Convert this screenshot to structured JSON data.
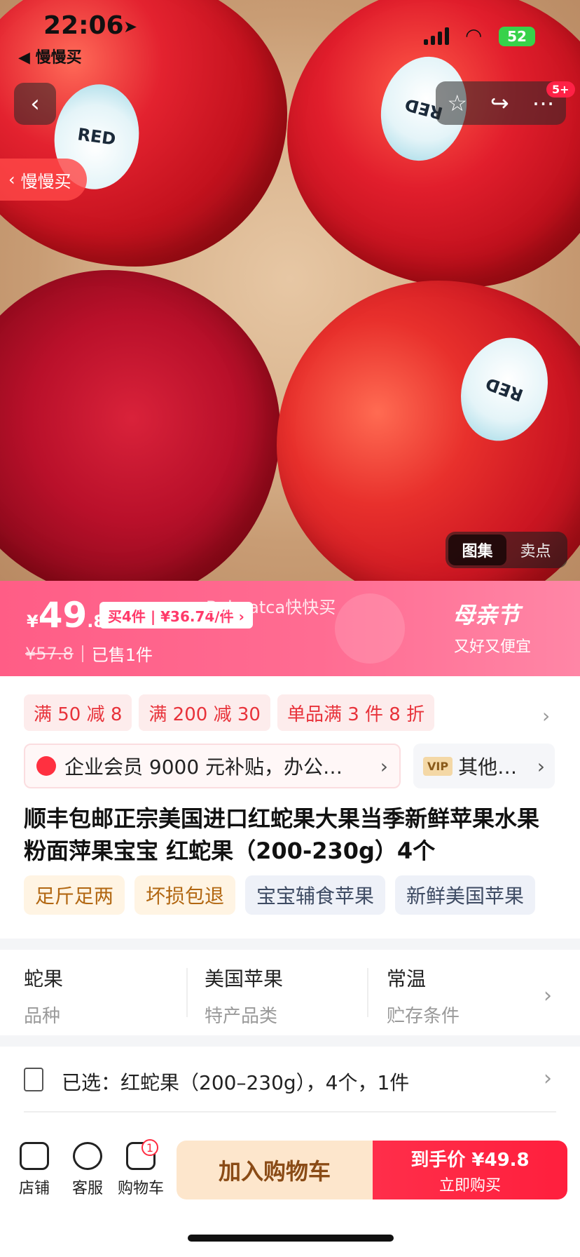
{
  "status_bar": {
    "time": "22:06",
    "back_app": "◀ 慢慢买",
    "battery": "52"
  },
  "hero": {
    "store_back_label": "慢慢买",
    "cart_badge": "5+",
    "gallery_tabs": [
      "图集",
      "卖点"
    ],
    "sticker_text": "RED"
  },
  "price": {
    "yen": "¥",
    "int": "49",
    "dec": ".8",
    "multi_offer": "买4件 | ¥36.74/件 ›",
    "watermark": "Babeatca快快买",
    "original": "¥57.8",
    "sold": "已售1件",
    "promo_title": "母亲节",
    "promo_sub": "又好又便宜"
  },
  "coupons": [
    "满 50 减 8",
    "满 200 减 30",
    "单品满 3 件 8 折"
  ],
  "member": {
    "text": "企业会员 9000 元补贴，办公…",
    "vip_tag": "VIP",
    "vip_text": "其他…"
  },
  "product_title": "顺丰包邮正宗美国进口红蛇果大果当季新鲜苹果水果粉面萍果宝宝 红蛇果（200-230g）4个",
  "tags": [
    "足斤足两",
    "坏损包退",
    "宝宝辅食苹果",
    "新鲜美国苹果"
  ],
  "attributes": [
    {
      "value": "蛇果",
      "key": "品种"
    },
    {
      "value": "美国苹果",
      "key": "特产品类"
    },
    {
      "value": "常温",
      "key": "贮存条件"
    }
  ],
  "selected": "已选：红蛇果（200–230g），4个，1件",
  "bottom_bar": {
    "shop": "店铺",
    "service": "客服",
    "cart": "购物车",
    "cart_count": "1",
    "add_to_cart": "加入购物车",
    "buy_top": "到手价 ¥49.8",
    "buy_bottom": "立即购买"
  }
}
